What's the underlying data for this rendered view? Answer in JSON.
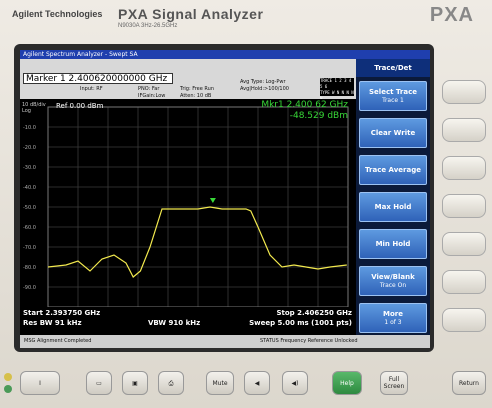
{
  "bezel": {
    "brand": "Agilent Technologies",
    "product": "PXA Signal Analyzer",
    "product_sub": "N9030A  3Hz-26.5GHz",
    "logo": "PXA"
  },
  "window": {
    "title": "Agilent Spectrum Analyzer - Swept SA"
  },
  "info": {
    "marker": "Marker 1  2.400620000000  GHz",
    "input": "Input: RF",
    "pno": "PNO: Far",
    "ifgain": "IFGain:Low",
    "trig": "Trig: Free Run",
    "atten": "Atten: 10 dB",
    "avg_type": "Avg Type: Log-Pwr",
    "avg_hold": "Avg|Hold:>100/100",
    "trace_row1": "TRACE 1 2 3 4 5 6",
    "trace_row2": "TYPE W N N N N N",
    "trace_row3": "DET P N N N N N"
  },
  "plot": {
    "scale_label": "10 dB/div",
    "scale_log": "Log",
    "ref_level": "Ref 0.00 dBm",
    "mkr_line1": "Mkr1 2.400 62  GHz",
    "mkr_line2": "-48.529  dBm",
    "y_ticks": [
      "-10.0",
      "-20.0",
      "-30.0",
      "-40.0",
      "-50.0",
      "-60.0",
      "-70.0",
      "-80.0",
      "-90.0"
    ]
  },
  "bottom": {
    "start": "Start 2.393750 GHz",
    "stop": "Stop 2.406250 GHz",
    "rbw": "Res BW 91 kHz",
    "vbw": "VBW 910 kHz",
    "sweep": "Sweep  5.00 ms (1001 pts)"
  },
  "status": {
    "left": "MSG  Alignment Completed",
    "right": "STATUS  Frequency Reference Unlocked"
  },
  "softkeys": {
    "title": "Trace/Det",
    "items": [
      {
        "label": "Select Trace",
        "sub": "Trace 1"
      },
      {
        "label": "Clear Write",
        "sub": ""
      },
      {
        "label": "Trace Average",
        "sub": ""
      },
      {
        "label": "Max Hold",
        "sub": ""
      },
      {
        "label": "Min Hold",
        "sub": ""
      },
      {
        "label": "View/Blank",
        "sub": "Trace On"
      },
      {
        "label": "More",
        "sub": "1 of 3"
      }
    ]
  },
  "hardkeys": {
    "power": "I",
    "mute": "Mute",
    "help": "Help",
    "full_screen": "Full Screen",
    "return": "Return"
  },
  "chart_data": {
    "type": "line",
    "xlabel": "",
    "ylabel": "",
    "xlim": [
      2.39375,
      2.40625
    ],
    "ylim": [
      -100,
      0
    ],
    "grid": true,
    "marker": {
      "x": 2.40062,
      "y": -48.529
    },
    "series": [
      {
        "x": [
          2.39375,
          2.3945,
          2.395,
          2.3955,
          2.396,
          2.3965,
          2.397,
          2.3973,
          2.3976,
          2.398,
          2.3985,
          2.399,
          2.3995,
          2.4,
          2.4005,
          2.401,
          2.4015,
          2.402,
          2.4022,
          2.4025,
          2.403,
          2.4035,
          2.404,
          2.4045,
          2.405,
          2.4055,
          2.4062
        ],
        "y": [
          -80,
          -79,
          -77,
          -82,
          -76,
          -74,
          -78,
          -85,
          -82,
          -70,
          -51,
          -51,
          -51,
          -51,
          -50,
          -51,
          -51,
          -51,
          -52,
          -60,
          -74,
          -80,
          -79,
          -80,
          -81,
          -80,
          -79
        ]
      }
    ]
  }
}
